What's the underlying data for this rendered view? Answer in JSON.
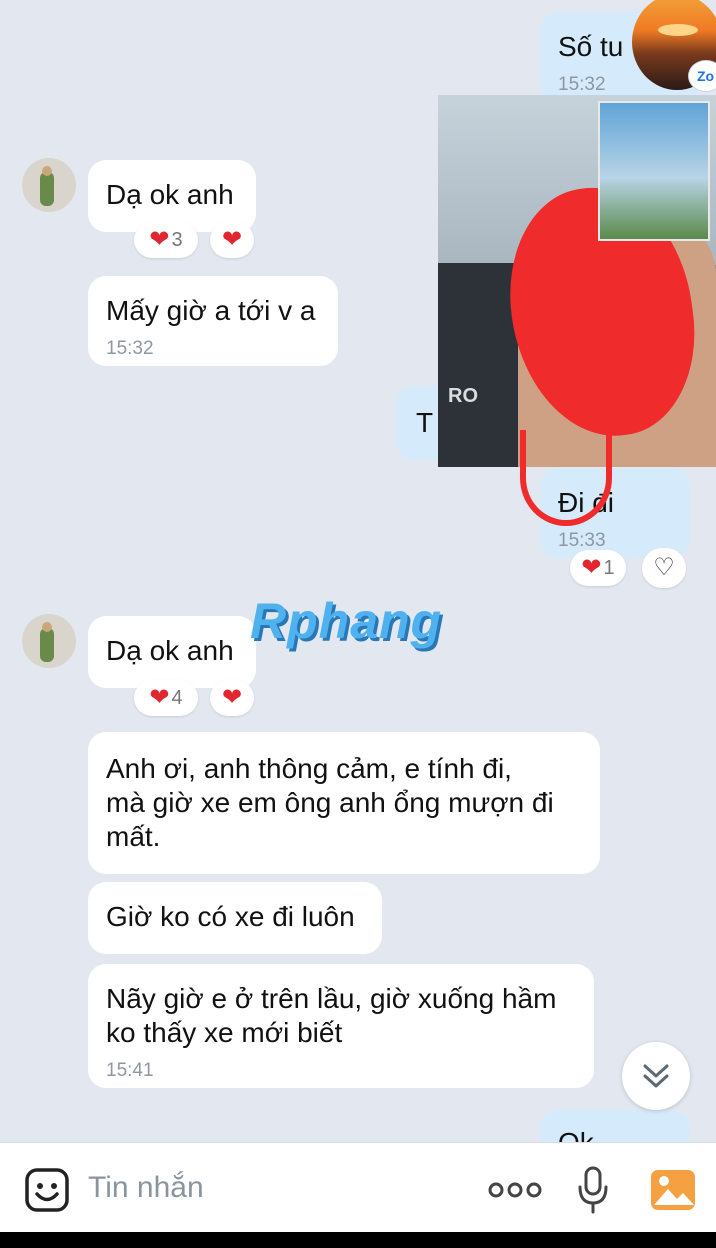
{
  "messages": {
    "so_tu": {
      "text": "Số tu",
      "time": "15:32"
    },
    "da_ok_1": {
      "text": "Dạ ok anh",
      "reaction_count": "3"
    },
    "may_gio": {
      "text": "Mấy giờ a tới v a",
      "time": "15:32"
    },
    "partial_out": {
      "text": "T"
    },
    "di_di": {
      "text": "Đi đi",
      "time": "15:33",
      "reaction_count": "1"
    },
    "da_ok_2": {
      "text": "Dạ ok anh",
      "reaction_count": "4"
    },
    "anh_oi": {
      "text": "Anh ơi, anh thông cảm, e tính đi,\nmà giờ xe em ông anh ổng mượn đi\nmất."
    },
    "gio_ko": {
      "text": "Giờ ko có xe đi luôn"
    },
    "nay_gio": {
      "text": "Nãy giờ e ở trên lầu, giờ xuống hầm\nko thấy xe mới biết",
      "time": "15:41"
    },
    "partial_bottom": {
      "text": "Ok"
    }
  },
  "watermark": {
    "text": "Rphang"
  },
  "zalo_badge": {
    "text": "Zo"
  },
  "composer": {
    "placeholder": "Tin nhắn"
  },
  "icons": {
    "emoji": "emoji-sticker-icon",
    "more": "more-dots-icon",
    "mic": "microphone-icon",
    "gallery": "gallery-image-icon",
    "scroll": "chevron-double-down-icon",
    "heart": "heart-icon"
  },
  "colors": {
    "background": "#e3e8f0",
    "incoming_bubble": "#ffffff",
    "outgoing_bubble": "#d5ebfc",
    "heart": "#e0262f",
    "gallery_orange": "#f5a142",
    "watermark_blue": "#4fb2ee"
  }
}
